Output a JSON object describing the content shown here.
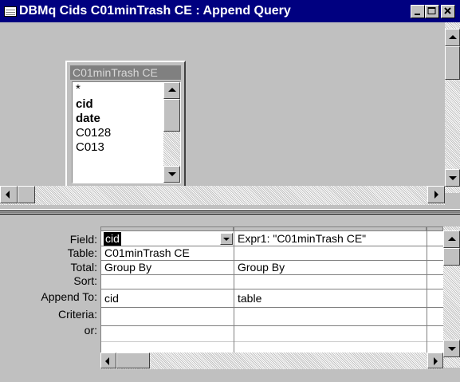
{
  "window": {
    "title": "DBMq Cids C01minTrash CE : Append Query",
    "icon": "query-design-icon",
    "colors": {
      "titlebar": "#000080",
      "face": "#c0c0c0"
    }
  },
  "field_list": {
    "title": "C01minTrash CE",
    "items": [
      {
        "label": "*",
        "bold": false
      },
      {
        "label": "cid",
        "bold": true
      },
      {
        "label": "date",
        "bold": true
      },
      {
        "label": "C0128",
        "bold": false
      },
      {
        "label": "C013",
        "bold": false
      }
    ]
  },
  "grid": {
    "row_labels": [
      "Field:",
      "Table:",
      "Total:",
      "Sort:",
      "Append To:",
      "Criteria:",
      "or:"
    ],
    "columns": [
      {
        "field": "cid",
        "table": "C01minTrash CE",
        "total": "Group By",
        "sort": "",
        "append_to": "cid",
        "criteria": "",
        "or": ""
      },
      {
        "field": "Expr1: \"C01minTrash CE\"",
        "table": "",
        "total": "Group By",
        "sort": "",
        "append_to": "table",
        "criteria": "",
        "or": ""
      }
    ]
  }
}
